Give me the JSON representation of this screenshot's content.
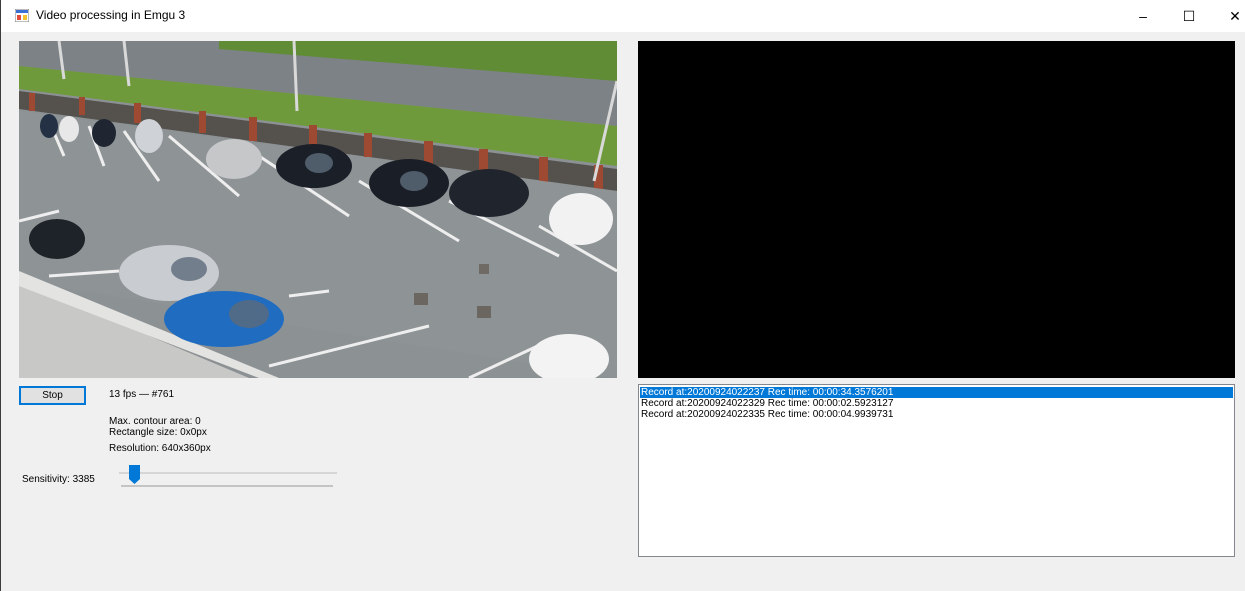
{
  "window": {
    "title": "Video processing in Emgu 3",
    "minimize_glyph": "–",
    "maximize_glyph": "☐",
    "close_glyph": "✕"
  },
  "controls": {
    "stop_label": "Stop",
    "fps_text": "13 fps — #761",
    "max_contour_area": "Max. contour area: 0",
    "rectangle_size": "Rectangle size: 0x0px",
    "resolution": "Resolution: 640x360px",
    "sensitivity_label": "Sensitivity: 3385",
    "sensitivity_level": 0.05
  },
  "records": [
    "Record at:20200924022237 Rec time: 00:00:34.3576201",
    "Record at:20200924022329 Rec time: 00:00:02.5923127",
    "Record at:20200924022335 Rec time: 00:00:04.9939731"
  ],
  "selected_record_index": 0,
  "colors": {
    "selection": "#0078d7",
    "output_background": "#000000",
    "form_background": "#f0f0f0"
  },
  "icons": {
    "app": "app-window-icon",
    "minimize": "minimize-icon",
    "maximize": "maximize-icon",
    "close": "close-icon"
  }
}
